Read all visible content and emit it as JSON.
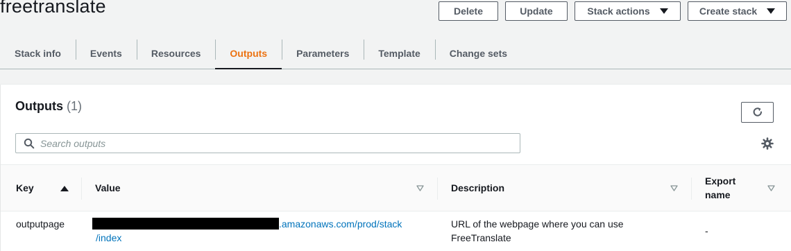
{
  "stack": {
    "name": "freetranslate"
  },
  "actions": {
    "delete": "Delete",
    "update": "Update",
    "stack_actions": "Stack actions",
    "create_stack": "Create stack"
  },
  "tabs": [
    {
      "label": "Stack info",
      "active": false
    },
    {
      "label": "Events",
      "active": false
    },
    {
      "label": "Resources",
      "active": false
    },
    {
      "label": "Outputs",
      "active": true
    },
    {
      "label": "Parameters",
      "active": false
    },
    {
      "label": "Template",
      "active": false
    },
    {
      "label": "Change sets",
      "active": false
    }
  ],
  "outputs": {
    "title": "Outputs",
    "count": "(1)",
    "search_placeholder": "Search outputs",
    "columns": {
      "key": "Key",
      "value": "Value",
      "description": "Description",
      "export_name": "Export name"
    },
    "rows": [
      {
        "key": "outputpage",
        "value_visible_part1": ".amazonaws.com/prod/stack",
        "value_visible_part2": "/index",
        "description": "URL of the webpage where you can use FreeTranslate",
        "export_name": "-"
      }
    ]
  },
  "colors": {
    "accent_active_tab": "#ec7211",
    "link": "#0073bb",
    "background": "#f2f3f3"
  },
  "icons": {
    "refresh": "refresh-icon",
    "search": "search-icon",
    "settings": "gear-icon",
    "sort_asc": "sort-ascending-icon",
    "sort": "sort-icon",
    "dropdown": "caret-down-icon"
  }
}
